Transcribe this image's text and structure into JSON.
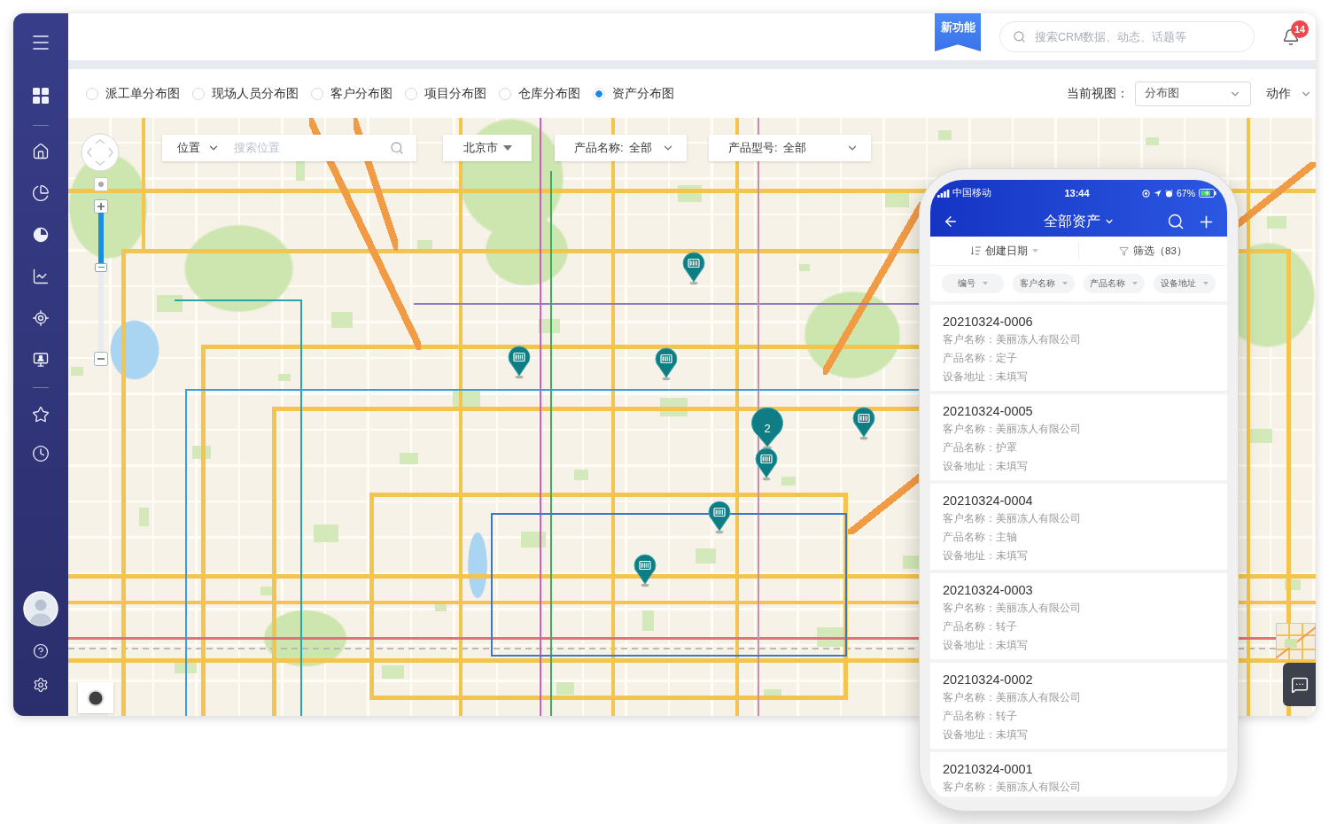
{
  "header": {
    "new_badge": "新功能",
    "search": {
      "placeholder": "搜索CRM数据、动态、话题等"
    },
    "notifications": {
      "count": "14"
    }
  },
  "view_tabs": [
    {
      "label": "派工单分布图",
      "selected": false
    },
    {
      "label": "现场人员分布图",
      "selected": false
    },
    {
      "label": "客户分布图",
      "selected": false
    },
    {
      "label": "项目分布图",
      "selected": false
    },
    {
      "label": "仓库分布图",
      "selected": false
    },
    {
      "label": "资产分布图",
      "selected": true
    }
  ],
  "view_selector": {
    "label": "当前视图：",
    "value": "分布图"
  },
  "actions_menu": {
    "label": "动作"
  },
  "map": {
    "zoom": {
      "level": 0.39
    },
    "location_search": {
      "scope": "位置",
      "placeholder": "搜索位置"
    },
    "filters": [
      {
        "kind": "city",
        "value": "北京市"
      },
      {
        "kind": "field",
        "label": "产品名称:",
        "value": "全部"
      },
      {
        "kind": "field",
        "label": "产品型号:",
        "value": "全部"
      }
    ],
    "markers": [
      {
        "kind": "pin"
      },
      {
        "kind": "pin"
      },
      {
        "kind": "pin"
      },
      {
        "kind": "pin"
      },
      {
        "kind": "cluster",
        "count": "2"
      },
      {
        "kind": "pin"
      },
      {
        "kind": "pin"
      },
      {
        "kind": "pin"
      }
    ]
  },
  "phone": {
    "status_bar": {
      "carrier": "中国移动",
      "time": "13:44",
      "battery": "67%"
    },
    "title": "全部资产",
    "sort": {
      "label": "创建日期"
    },
    "filter": {
      "label": "筛选（83）"
    },
    "columns": [
      "编号",
      "客户名称",
      "产品名称",
      "设备地址"
    ],
    "records": [
      {
        "id": "20210324-0006",
        "fields": [
          "客户名称：美丽冻人有限公司",
          "产品名称：定子",
          "设备地址：未填写"
        ]
      },
      {
        "id": "20210324-0005",
        "fields": [
          "客户名称：美丽冻人有限公司",
          "产品名称：护罩",
          "设备地址：未填写"
        ]
      },
      {
        "id": "20210324-0004",
        "fields": [
          "客户名称：美丽冻人有限公司",
          "产品名称：主轴",
          "设备地址：未填写"
        ]
      },
      {
        "id": "20210324-0003",
        "fields": [
          "客户名称：美丽冻人有限公司",
          "产品名称：转子",
          "设备地址：未填写"
        ]
      },
      {
        "id": "20210324-0002",
        "fields": [
          "客户名称：美丽冻人有限公司",
          "产品名称：转子",
          "设备地址：未填写"
        ]
      },
      {
        "id": "20210324-0001",
        "fields": [
          "客户名称：美丽冻人有限公司"
        ]
      }
    ]
  }
}
